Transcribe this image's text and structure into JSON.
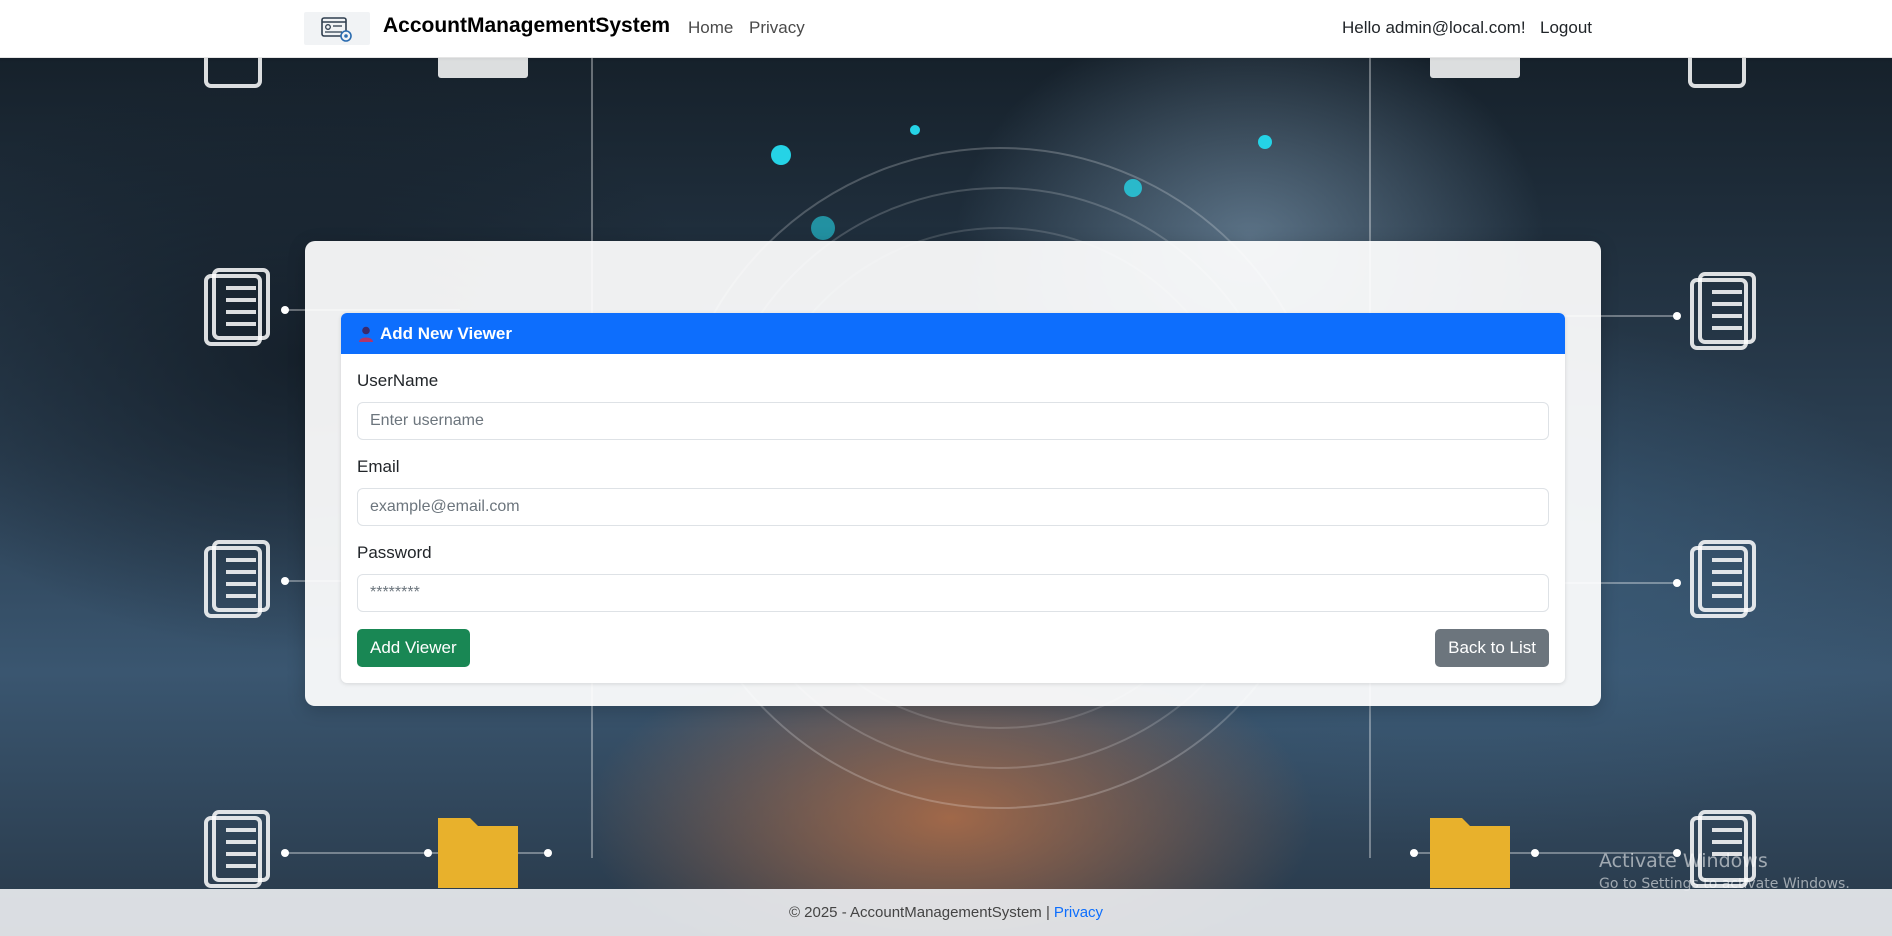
{
  "navbar": {
    "brand": "AccountManagementSystem",
    "links": {
      "home": "Home",
      "privacy": "Privacy"
    },
    "greeting": "Hello admin@local.com!",
    "logout": "Logout"
  },
  "form": {
    "title": "Add New Viewer",
    "username": {
      "label": "UserName",
      "placeholder": "Enter username"
    },
    "email": {
      "label": "Email",
      "placeholder": "example@email.com"
    },
    "password": {
      "label": "Password",
      "placeholder": "********"
    },
    "submit_label": "Add Viewer",
    "back_label": "Back to List"
  },
  "watermark": {
    "title": "Activate Windows",
    "subtitle": "Go to Settings to activate Windows."
  },
  "footer": {
    "text": "© 2025 - AccountManagementSystem |",
    "privacy_link": "Privacy"
  },
  "colors": {
    "primary": "#0d6efd",
    "success": "#198754",
    "secondary": "#6c757d"
  }
}
